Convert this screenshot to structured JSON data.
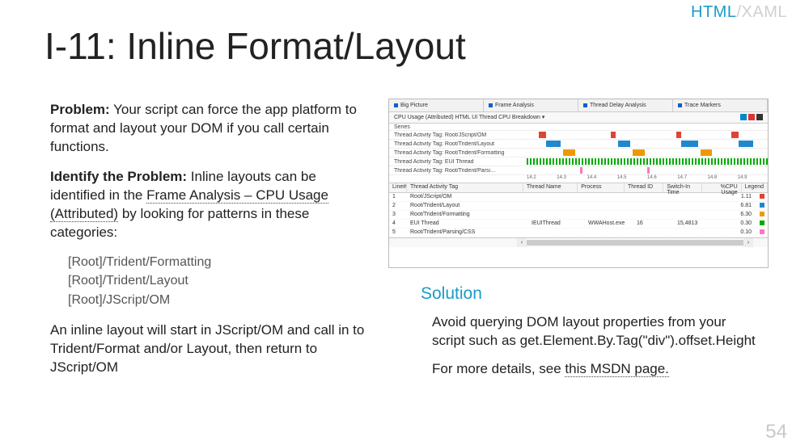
{
  "corner": {
    "html": "HTML",
    "xaml": "/XAML"
  },
  "title": "I-11: Inline Format/Layout",
  "left": {
    "problem_label": "Problem:",
    "problem_text": " Your script can force the app platform to format and layout your DOM if you call certain functions.",
    "identify_label": "Identify the Problem:",
    "identify_text_pre": " Inline layouts can be identified in the ",
    "identify_link": "Frame Analysis – CPU Usage (Attributed)",
    "identify_text_post": " by looking for patterns in these categories:",
    "categories": [
      "[Root]/Trident/Formatting",
      "[Root]/Trident/Layout",
      "[Root]/JScript/OM"
    ],
    "inline_text": "An inline layout will start in JScript/OM and call in to Trident/Format and/or Layout, then return to JScript/OM"
  },
  "right": {
    "solution_label": "Solution",
    "solution_text": "Avoid querying DOM layout properties from your script such as get.Element.By.Tag(\"div\").offset.Height",
    "more_pre": "For more details, see ",
    "more_link": "this MSDN page.",
    "more_post": ""
  },
  "page_num": "54",
  "screenshot": {
    "tabs": [
      "Big Picture",
      "Frame Analysis",
      "Thread Delay Analysis",
      "Trace Markers"
    ],
    "subhead_left": "CPU Usage (Attributed)  HTML UI Thread CPU Breakdown ▾",
    "subhead_right": "",
    "series_label": "Series",
    "threads": [
      "Thread Activity Tag: Root/JScript/OM",
      "Thread Activity Tag: Root/Trident/Layout",
      "Thread Activity Tag: Root/Trident/Formatting",
      "Thread Activity Tag: EUI Thread",
      "Thread Activity Tag: Root/Trident/Parsi…"
    ],
    "axis": [
      "14.2",
      "14.3",
      "14.4",
      "14.5",
      "14.6",
      "14.7",
      "14.8",
      "14.9"
    ],
    "table_head": [
      "Line#",
      "Thread Activity Tag",
      "Thread Name",
      "Process",
      "Thread ID",
      "Switch-In Time",
      "%CPU Usage",
      "Legend"
    ],
    "rows": [
      {
        "line": "1",
        "tag": "Root/JScript/OM",
        "name": "",
        "proc": "",
        "tid": "",
        "sw": "",
        "usage": "1.11",
        "color": "#d43"
      },
      {
        "line": "2",
        "tag": "Root/Trident/Layout",
        "name": "",
        "proc": "",
        "tid": "",
        "sw": "",
        "usage": "6.81",
        "color": "#28c"
      },
      {
        "line": "3",
        "tag": "Root/Trident/Formatting",
        "name": "",
        "proc": "",
        "tid": "",
        "sw": "",
        "usage": "6.30",
        "color": "#e90"
      },
      {
        "line": "4",
        "tag": "EUI Thread",
        "name": "IEUIThread",
        "proc": "WWAHost.exe",
        "tid": "16",
        "sw": "15,4813",
        "usage": "0.30",
        "color": "#0a0"
      },
      {
        "line": "5",
        "tag": "Root/Trident/Parsing/CSS",
        "name": "",
        "proc": "",
        "tid": "",
        "sw": "",
        "usage": "0.10",
        "color": "#f7b"
      }
    ]
  }
}
